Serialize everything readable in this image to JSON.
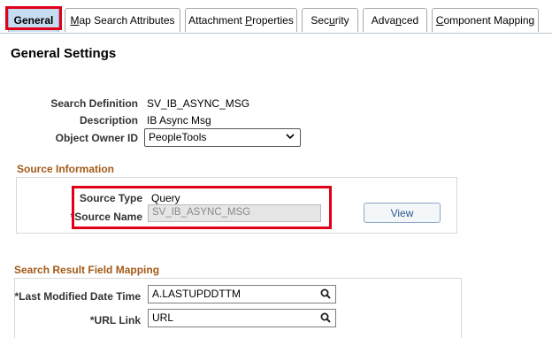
{
  "tabs": [
    {
      "label": "General",
      "active": true
    },
    {
      "label_pre": "",
      "label_u": "M",
      "label_post": "ap Search Attributes"
    },
    {
      "label_pre": "Attachment ",
      "label_u": "P",
      "label_post": "roperties"
    },
    {
      "label_pre": "Sec",
      "label_u": "u",
      "label_post": "rity"
    },
    {
      "label_pre": "Adva",
      "label_u": "n",
      "label_post": "ced"
    },
    {
      "label_pre": "",
      "label_u": "C",
      "label_post": "omponent Mapping"
    }
  ],
  "page_title": "General Settings",
  "general": {
    "search_definition_label": "Search Definition",
    "search_definition_value": "SV_IB_ASYNC_MSG",
    "description_label": "Description",
    "description_value": "IB Async Msg",
    "object_owner_label": "Object Owner ID",
    "object_owner_value": "PeopleTools"
  },
  "source": {
    "section_title": "Source Information",
    "source_type_label": "Source Type",
    "source_type_value": "Query",
    "source_name_label": "*Source Name",
    "source_name_value": "SV_IB_ASYNC_MSG",
    "view_button": "View"
  },
  "mapping": {
    "section_title": "Search Result Field Mapping",
    "last_modified_label": "*Last Modified Date Time",
    "last_modified_value": "A.LASTUPDDTTM",
    "url_link_label": "*URL Link",
    "url_link_value": "URL"
  },
  "colors": {
    "highlight": "#e0001a",
    "section_title": "#a35a17",
    "active_tab": "#c6dcf1"
  }
}
